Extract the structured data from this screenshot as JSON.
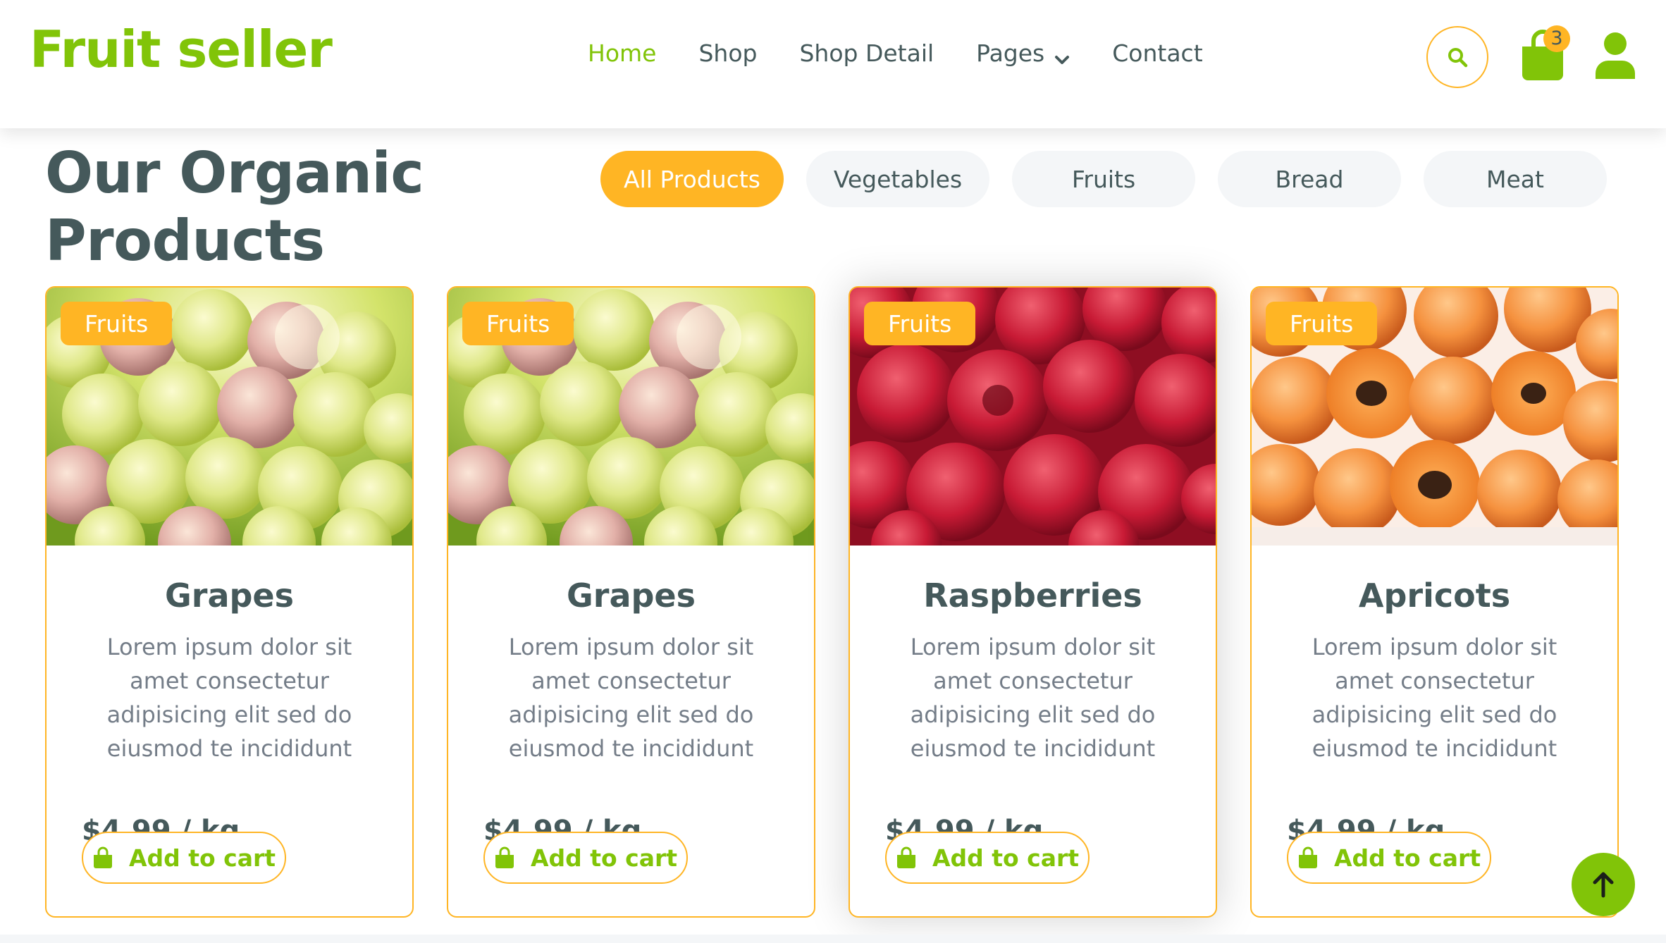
{
  "brand": {
    "name": "Fruit seller",
    "color": "#81c408"
  },
  "nav": {
    "items": [
      {
        "label": "Home",
        "active": true
      },
      {
        "label": "Shop"
      },
      {
        "label": "Shop Detail"
      },
      {
        "label": "Pages",
        "has_dropdown": true,
        "icon": "chevron-down-icon"
      },
      {
        "label": "Contact"
      }
    ]
  },
  "header_actions": {
    "search_icon": "search-icon",
    "cart_icon": "shopping-bag-icon",
    "cart_count": "3",
    "user_icon": "user-icon"
  },
  "section": {
    "title": "Our Organic Products",
    "filters": [
      {
        "label": "All Products",
        "active": true
      },
      {
        "label": "Vegetables"
      },
      {
        "label": "Fruits"
      },
      {
        "label": "Bread"
      },
      {
        "label": "Meat"
      }
    ]
  },
  "products": [
    {
      "category": "Fruits",
      "name": "Grapes",
      "description": "Lorem ipsum dolor sit amet consectetur adipisicing elit sed do eiusmod te incididunt",
      "price": "$4.99 / kg",
      "button": "Add to cart",
      "image": "grapes"
    },
    {
      "category": "Fruits",
      "name": "Grapes",
      "description": "Lorem ipsum dolor sit amet consectetur adipisicing elit sed do eiusmod te incididunt",
      "price": "$4.99 / kg",
      "button": "Add to cart",
      "image": "grapes"
    },
    {
      "category": "Fruits",
      "name": "Raspberries",
      "description": "Lorem ipsum dolor sit amet consectetur adipisicing elit sed do eiusmod te incididunt",
      "price": "$4.99 / kg",
      "button": "Add to cart",
      "image": "raspberries"
    },
    {
      "category": "Fruits",
      "name": "Apricots",
      "description": "Lorem ipsum dolor sit amet consectetur adipisicing elit sed do eiusmod te incididunt",
      "price": "$4.99 / kg",
      "button": "Add to cart",
      "image": "apricots"
    }
  ],
  "back_to_top_icon": "arrow-up-icon",
  "colors": {
    "primary": "#81c408",
    "secondary": "#ffb524",
    "text": "#45595b",
    "muted": "#747d88"
  }
}
